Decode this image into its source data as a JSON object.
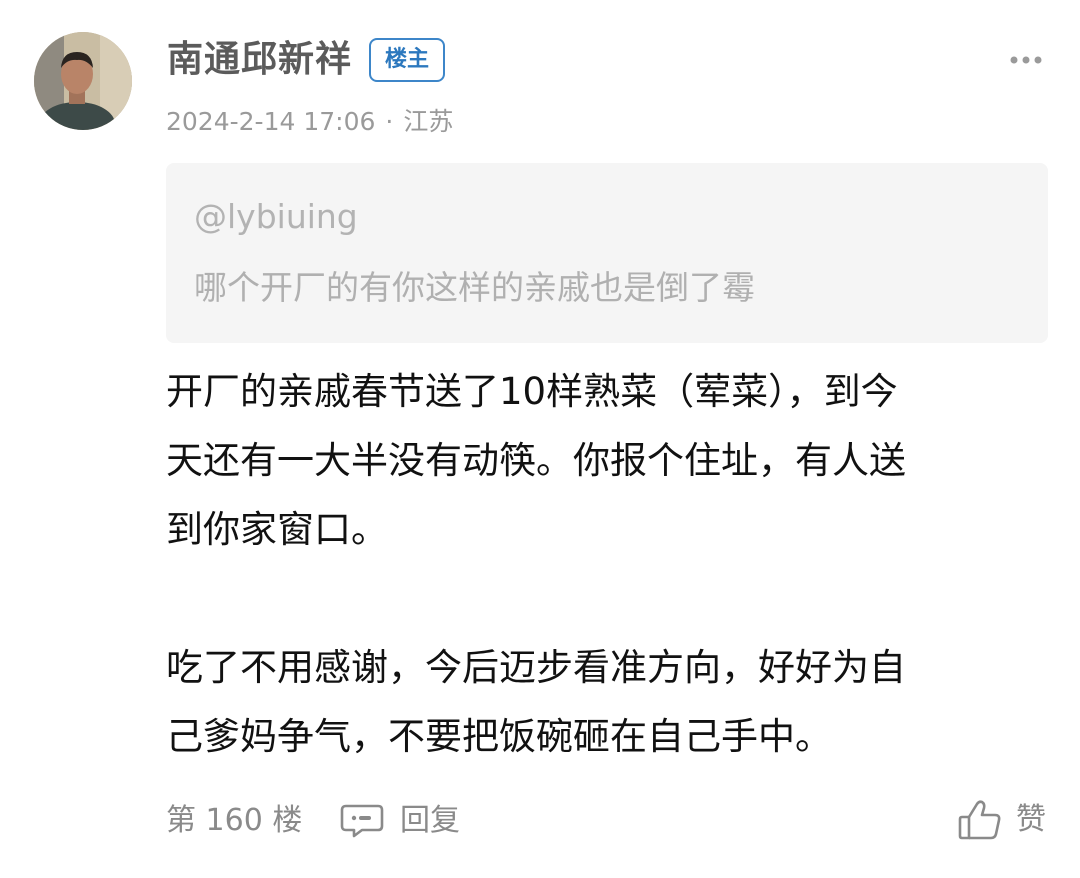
{
  "post": {
    "username": "南通邱新祥",
    "badge": "楼主",
    "date": "2024-2-14 17:06",
    "separator": "·",
    "location": "江苏",
    "quote": {
      "user": "@lybiuing",
      "text": "哪个开厂的有你这样的亲戚也是倒了霉"
    },
    "content": {
      "line1": "开厂的亲戚春节送了10样熟菜（荤菜），到今",
      "line2": "天还有一大半没有动筷。你报个住址，有人送",
      "line3": "到你家窗口。",
      "line4": "吃了不用感谢，今后迈步看准方向，好好为自",
      "line5": "己爹妈争气，不要把饭碗砸在自己手中。"
    },
    "floor": "第 160 楼",
    "reply_label": "回复",
    "like_label": "赞"
  },
  "icons": {
    "avatar": "avatar",
    "more": "more-dots-icon",
    "reply": "comment-bubble-icon",
    "like": "thumbs-up-icon"
  },
  "colors": {
    "badge_blue": "#3d86c9",
    "quote_background": "#f5f5f5",
    "secondary_text": "#8a8a8a"
  }
}
